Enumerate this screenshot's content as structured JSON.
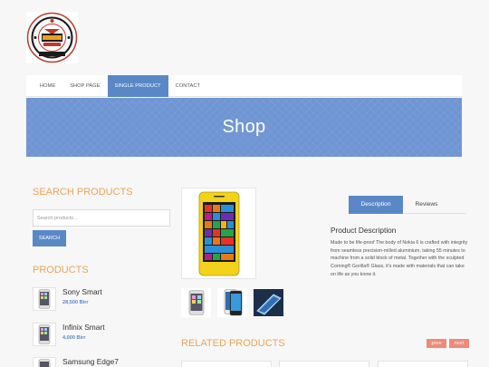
{
  "logo": {
    "icon": "store-seal-logo"
  },
  "nav": {
    "items": [
      "HOME",
      "SHOP PAGE",
      "SINGLE PRODUCT",
      "CONTACT"
    ],
    "active_index": 2
  },
  "banner": {
    "title": "Shop"
  },
  "sidebar": {
    "search_heading": "SEARCH PRODUCTS",
    "search_placeholder": "Search products...",
    "search_button": "SEARCH",
    "products_heading": "PRODUCTS",
    "products": [
      {
        "name": "Sony Smart",
        "price": "28,500 Birr"
      },
      {
        "name": "Infinix Smart",
        "price": "4,000 Birr"
      },
      {
        "name": "Samsung Edge7",
        "price": ""
      }
    ]
  },
  "product": {
    "tabs": [
      "Description",
      "Reviews"
    ],
    "active_tab": 0,
    "description_title": "Product Description",
    "description_text": "Made to be life-proof The body of Nokia 6 is crafted with integrity from seamless precision-milled aluminium, taking 55 minutes to machine from a solid block of metal. Together with the sculpted Corning® Gorilla® Glass, it's made with materials that can take on life as you know it."
  },
  "related": {
    "heading": "RELATED PRODUCTS",
    "prev_label": "prev",
    "next_label": "next"
  },
  "colors": {
    "accent": "#5a88c6",
    "heading": "#f0a356",
    "pager": "#f08a78"
  }
}
